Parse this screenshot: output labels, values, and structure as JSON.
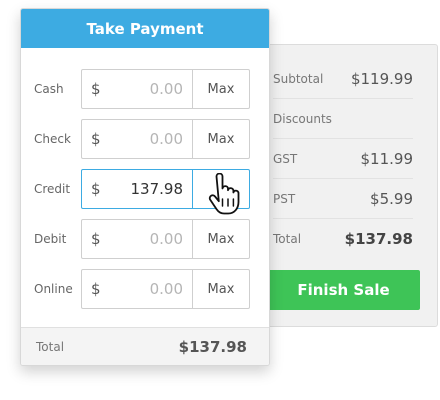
{
  "payment": {
    "title": "Take Payment",
    "currency_symbol": "$",
    "methods": [
      {
        "label": "Cash",
        "value": "0.00",
        "max_label": "Max",
        "active": false
      },
      {
        "label": "Check",
        "value": "0.00",
        "max_label": "Max",
        "active": false
      },
      {
        "label": "Credit",
        "value": "137.98",
        "max_label": "",
        "active": true
      },
      {
        "label": "Debit",
        "value": "0.00",
        "max_label": "Max",
        "active": false
      },
      {
        "label": "Online",
        "value": "0.00",
        "max_label": "Max",
        "active": false
      }
    ],
    "footer": {
      "label": "Total",
      "value": "$137.98"
    }
  },
  "summary": {
    "rows": [
      {
        "label": "Subtotal",
        "value": "$119.99"
      },
      {
        "label": "Discounts",
        "value": ""
      },
      {
        "label": "GST",
        "value": "$11.99"
      },
      {
        "label": "PST",
        "value": "$5.99"
      },
      {
        "label": "Total",
        "value": "$137.98"
      }
    ],
    "finish_label": "Finish Sale"
  },
  "colors": {
    "header_blue": "#3dabe2",
    "finish_green": "#3ec457",
    "active_border": "#3dabe2"
  },
  "icons": {
    "cursor": "hand-pointer-icon"
  }
}
